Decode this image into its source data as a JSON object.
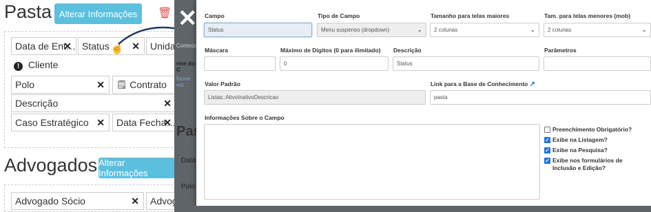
{
  "background": {
    "pasta_title": "Pasta",
    "pasta_button": "Alterar Informações",
    "advogados_title": "Advogados",
    "advogados_button": "Alterar Informações",
    "pasta_fields": {
      "data_entrada": "Data de Ent…",
      "status": "Status",
      "unidade": "Unidad",
      "cliente": "Cliente",
      "polo": "Polo",
      "contrato": "Contrato",
      "descricao": "Descrição",
      "caso_estrategico": "Caso Estratégico",
      "data_fecha": "Data Fecha…"
    },
    "advogados_fields": {
      "advogado_socio": "Advogado Sócio",
      "advoga": "Advoga"
    },
    "overlay_fragments": [
      "Conteúdo",
      "rme do C",
      "forme est",
      "Pas",
      "Data",
      "Polo"
    ]
  },
  "modal": {
    "campo_label": "Campo",
    "campo_value": "Status",
    "tipo_label": "Tipo de Campo",
    "tipo_value": "Menu suspenso (dropdown)",
    "tamanho_maior_label": "Tamanho para telas maiores",
    "tamanho_maior_value": "2 colunas",
    "tamanho_menor_label": "Tam. para telas menores (mob)",
    "tamanho_menor_value": "2 colunas",
    "mascara_label": "Máscara",
    "mascara_value": "",
    "max_digitos_label": "Máximo de Dígitos (0 para ilimitado)",
    "max_digitos_value": "0",
    "descricao_label": "Descrição",
    "descricao_value": "Status",
    "parametros_label": "Parâmetros",
    "parametros_value": "",
    "valor_padrao_label": "Valor Padrão",
    "valor_padrao_value": "Listas::AtivoInativoDescricao",
    "link_label": "Link para a Base de Conhecimento",
    "link_value": "pasta",
    "info_label": "Informações Sobre o Campo",
    "info_value": "",
    "checkboxes": [
      {
        "label": "Preenchimento Obrigatório?",
        "checked": false
      },
      {
        "label": "Exibe na Listagem?",
        "checked": true
      },
      {
        "label": "Exibe na Pesquisa?",
        "checked": true
      },
      {
        "label": "Exibe nos formulários de Inclusão e Edição?",
        "checked": true
      }
    ]
  },
  "colors": {
    "accent_button": "#5bc0de",
    "overlay": "#5f6468",
    "checkbox_checked": "#1a73e8",
    "trash": "#d9534f"
  }
}
